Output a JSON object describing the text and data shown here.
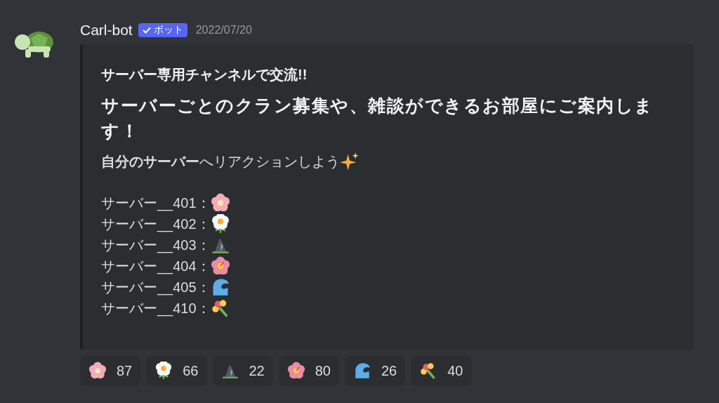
{
  "message": {
    "author": "Carl-bot",
    "badge": "ボット",
    "badge_verified": true,
    "timestamp": "2022/07/20"
  },
  "embed": {
    "title": "サーバー専用チャンネルで交流!!",
    "heading": "サーバーごとのクラン募集や、雑談ができるお部屋にご案内します！",
    "prompt": "**自分のサーバー**へリアクションしよう",
    "prompt_emoji": {
      "kind": "sparkles"
    },
    "servers": [
      {
        "label": "サーバー__401：",
        "emoji": {
          "kind": "blossom"
        }
      },
      {
        "label": "サーバー__402：",
        "emoji": {
          "kind": "daisy"
        }
      },
      {
        "label": "サーバー__403：",
        "emoji": {
          "kind": "rock"
        }
      },
      {
        "label": "サーバー__404：",
        "emoji": {
          "kind": "hibiscus"
        }
      },
      {
        "label": "サーバー__405：",
        "emoji": {
          "kind": "wave"
        }
      },
      {
        "label": "サーバー__410：",
        "emoji": {
          "kind": "bouquet"
        }
      }
    ]
  },
  "reactions": [
    {
      "emoji": {
        "kind": "blossom"
      },
      "count": "87"
    },
    {
      "emoji": {
        "kind": "daisy"
      },
      "count": "66"
    },
    {
      "emoji": {
        "kind": "rock"
      },
      "count": "22"
    },
    {
      "emoji": {
        "kind": "hibiscus"
      },
      "count": "80"
    },
    {
      "emoji": {
        "kind": "wave"
      },
      "count": "26"
    },
    {
      "emoji": {
        "kind": "bouquet"
      },
      "count": "40"
    }
  ]
}
